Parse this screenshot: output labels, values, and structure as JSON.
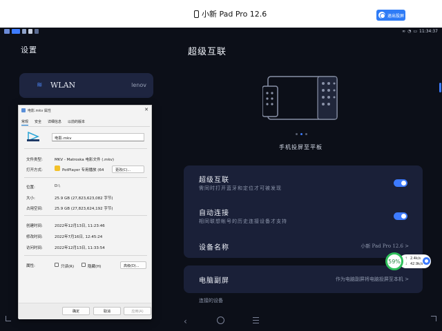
{
  "topbar": {
    "device_name": "小新 Pad Pro 12.6",
    "exit_button": "退出投屏"
  },
  "statusbar": {
    "time": "11:34:37"
  },
  "settings": {
    "left_title": "设置",
    "wlan_label": "WLAN",
    "wlan_value": "lenov",
    "right_title": "超级互联",
    "illustration_caption": "手机投屏至平板",
    "rows": [
      {
        "title": "超级互联",
        "subtitle": "需同时打开蓝牙和定位才可被发现",
        "toggle": true
      },
      {
        "title": "自动连接",
        "subtitle": "相同联想帐号的历史连接设备才支持",
        "toggle": true
      },
      {
        "title": "设备名称",
        "value": "小新 Pad Pro 12.6 >"
      }
    ],
    "pc_row": {
      "title": "电脑副屏",
      "value": "作为电脑副屏将电脑投屏至本机 >"
    },
    "section_label": "连接的设备"
  },
  "speed_widget": {
    "percent": "59%",
    "upload": "2.4k/s",
    "download": "42.9k/s"
  },
  "dialog": {
    "title": "电影.mkv 属性",
    "close_glyph": "✕",
    "tabs": [
      "常规",
      "安全",
      "详细信息",
      "以前的版本"
    ],
    "file_name": "电影.mkv",
    "fields": [
      {
        "label": "文件类型:",
        "value": "MKV - Matroska 电影文件 (.mkv)"
      },
      {
        "label": "打开方式:",
        "value": "PotPlayer 专用播放 (64"
      },
      {
        "label": "位置:",
        "value": "D:\\"
      },
      {
        "label": "大小:",
        "value": "25.9 GB (27,823,623,082 字节)"
      },
      {
        "label": "占用空间:",
        "value": "25.9 GB (27,823,624,192 字节)"
      },
      {
        "label": "创建时间:",
        "value": "2022年12月13日, 11:23:46"
      },
      {
        "label": "修改时间:",
        "value": "2022年7月16日, 12:45:24"
      },
      {
        "label": "访问时间:",
        "value": "2022年12月13日, 11:33:54"
      },
      {
        "label": "属性:",
        "value": ""
      }
    ],
    "change_button": "更改(C)...",
    "attr_readonly": "只读(R)",
    "attr_hidden": "隐藏(H)",
    "advanced_button": "高级(D)...",
    "ok_button": "确定",
    "cancel_button": "取消",
    "apply_button": "应用(A)"
  },
  "colors": {
    "accent": "#3d7bff",
    "screen_bg": "#0c0f18",
    "card_bg": "#1a2038",
    "speed_ring": "#2fbf5b"
  }
}
